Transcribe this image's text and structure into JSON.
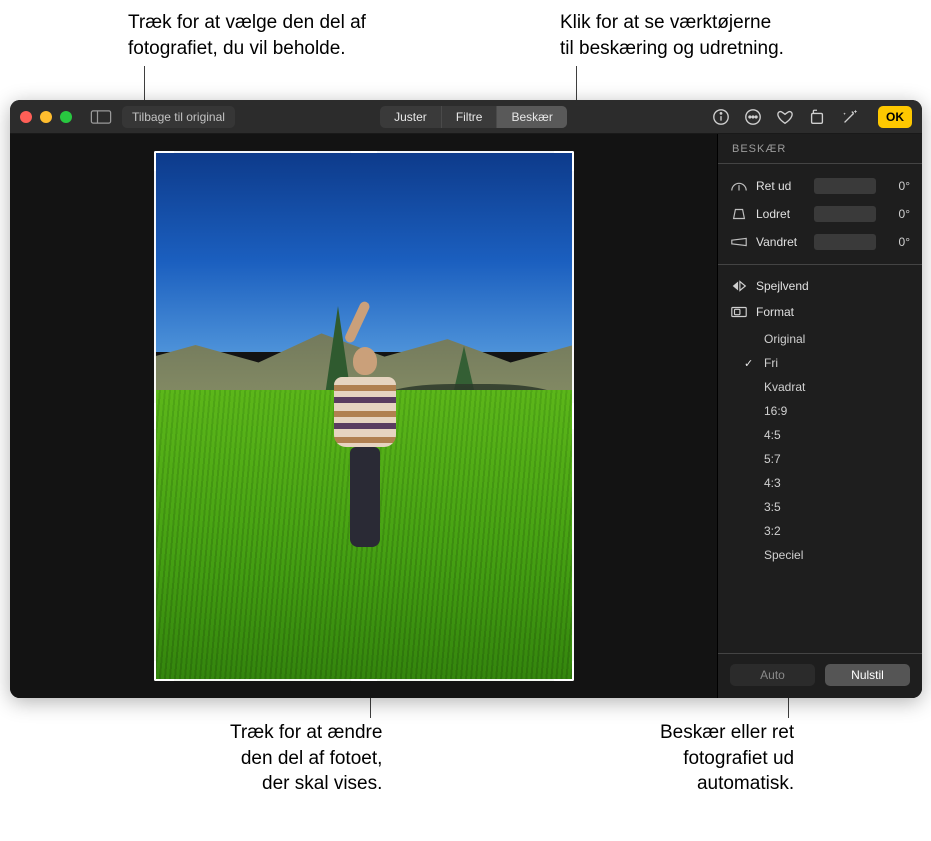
{
  "callouts": {
    "top_left": "Træk for at vælge den del af\nfotografiet, du vil beholde.",
    "top_right": "Klik for at se værktøjerne\ntil beskæring og udretning.",
    "bottom_left": "Træk for at ændre\nden del af fotoet,\nder skal vises.",
    "bottom_right": "Beskær eller ret\nfotografiet ud\nautomatisk."
  },
  "toolbar": {
    "revert_label": "Tilbage til original",
    "tabs": {
      "adjust": "Juster",
      "filters": "Filtre",
      "crop": "Beskær"
    },
    "active_tab": "crop",
    "done_label": "OK"
  },
  "panel": {
    "header": "BESKÆR",
    "sliders": {
      "straighten": {
        "label": "Ret ud",
        "value": "0°"
      },
      "vertical": {
        "label": "Lodret",
        "value": "0°"
      },
      "horizontal": {
        "label": "Vandret",
        "value": "0°"
      }
    },
    "flip_label": "Spejlvend",
    "aspect_header": "Format",
    "aspects": [
      {
        "label": "Original",
        "selected": false
      },
      {
        "label": "Fri",
        "selected": true
      },
      {
        "label": "Kvadrat",
        "selected": false
      },
      {
        "label": "16:9",
        "selected": false
      },
      {
        "label": "4:5",
        "selected": false
      },
      {
        "label": "5:7",
        "selected": false
      },
      {
        "label": "4:3",
        "selected": false
      },
      {
        "label": "3:5",
        "selected": false
      },
      {
        "label": "3:2",
        "selected": false
      },
      {
        "label": "Speciel",
        "selected": false
      }
    ],
    "footer": {
      "auto": "Auto",
      "reset": "Nulstil"
    }
  },
  "colors": {
    "accent": "#fec800"
  }
}
